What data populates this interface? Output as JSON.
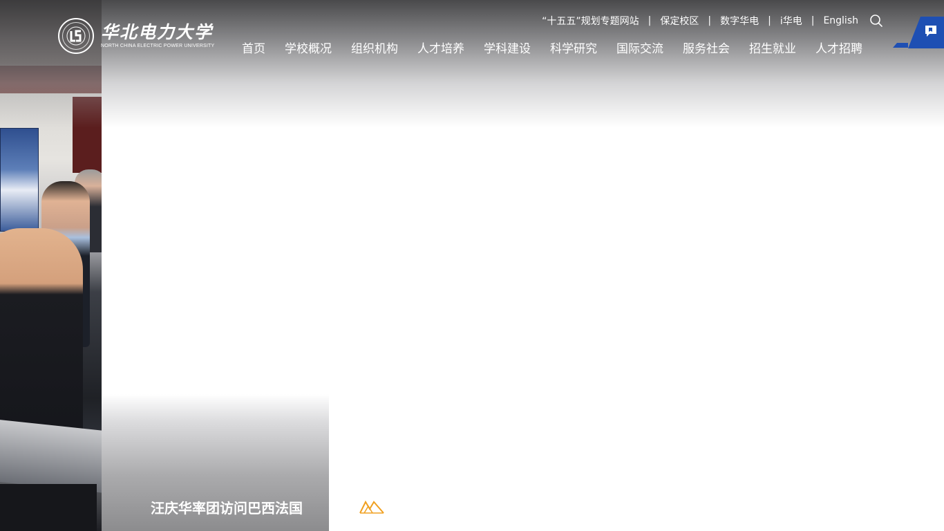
{
  "brand": {
    "name_cn": "华北电力大学",
    "name_en": "NORTH CHINA ELECTRIC POWER UNIVERSITY",
    "emblem_icon": "university-emblem-icon"
  },
  "utility_links": [
    {
      "label": "“十五五”规划专题网站"
    },
    {
      "label": "保定校区"
    },
    {
      "label": "数字华电"
    },
    {
      "label": "i华电"
    },
    {
      "label": "English"
    }
  ],
  "separator": "|",
  "search_icon": "search-icon",
  "side_tab_icon": "bookmark-chat-icon",
  "nav": [
    {
      "label": "首页"
    },
    {
      "label": "学校概况"
    },
    {
      "label": "组织机构"
    },
    {
      "label": "人才培养"
    },
    {
      "label": "学科建设"
    },
    {
      "label": "科学研究"
    },
    {
      "label": "国际交流"
    },
    {
      "label": "服务社会"
    },
    {
      "label": "招生就业"
    },
    {
      "label": "人才招聘"
    }
  ],
  "slide": {
    "caption": "汪庆华率团访问巴西法国",
    "mark_icon": "logo-mark-icon"
  },
  "colors": {
    "accent_blue": "#1e4fb3",
    "mark_orange": "#f0a020",
    "text_white": "#ffffff"
  }
}
